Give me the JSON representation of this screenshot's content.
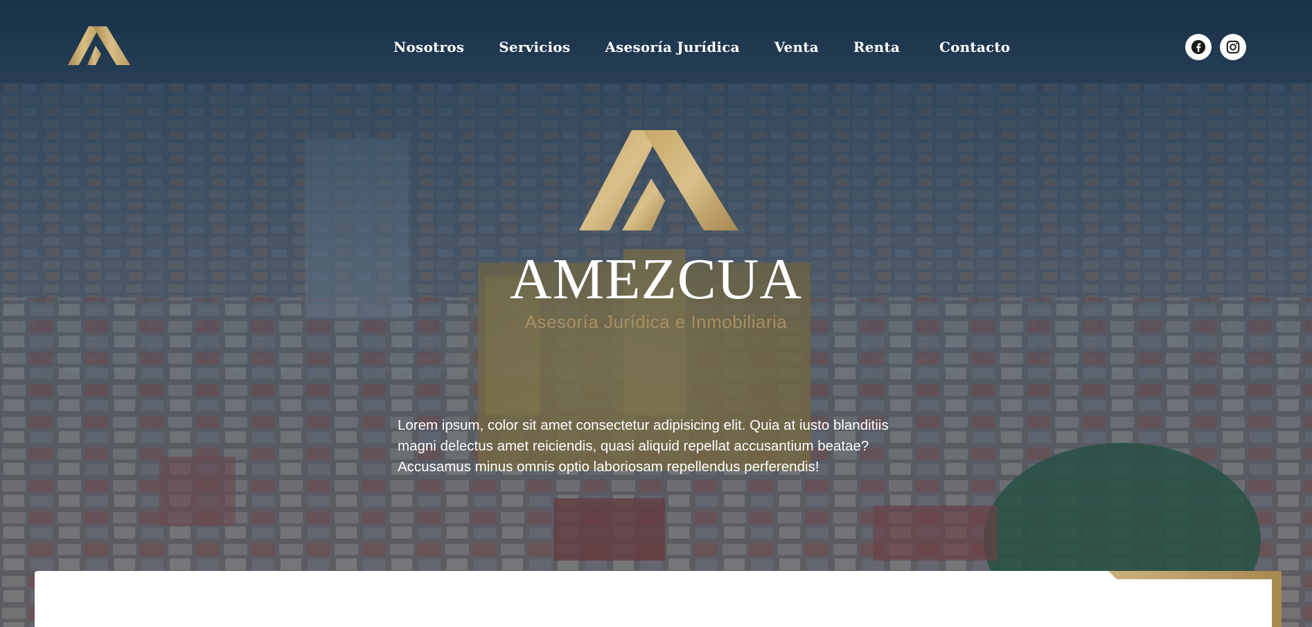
{
  "nav": {
    "logo_icon": "amezcua-logo-icon",
    "items": [
      {
        "label": "Nosotros"
      },
      {
        "label": "Servicios"
      },
      {
        "label": "Asesoría Jurídica"
      },
      {
        "label": "Venta"
      },
      {
        "label": "Renta"
      },
      {
        "label": "Contacto"
      }
    ],
    "social": [
      {
        "icon": "facebook-icon"
      },
      {
        "icon": "instagram-icon"
      }
    ]
  },
  "hero": {
    "brand": "AMEZCUA",
    "tagline": "Asesoría Jurídica e Inmobiliaria",
    "text": "Lorem ipsum, color sit amet consectetur adipisicing elit. Quia at iusto blanditiis magni delectus amet reiciendis, quasi aliquid repellat accusantium beatae? Accusamus minus omnis optio laboriosam repellendus perferendis!"
  },
  "colors": {
    "gold": "#b89a5e",
    "gold_light": "#d9c08a",
    "navy": "#1b3550",
    "white": "#ffffff"
  }
}
